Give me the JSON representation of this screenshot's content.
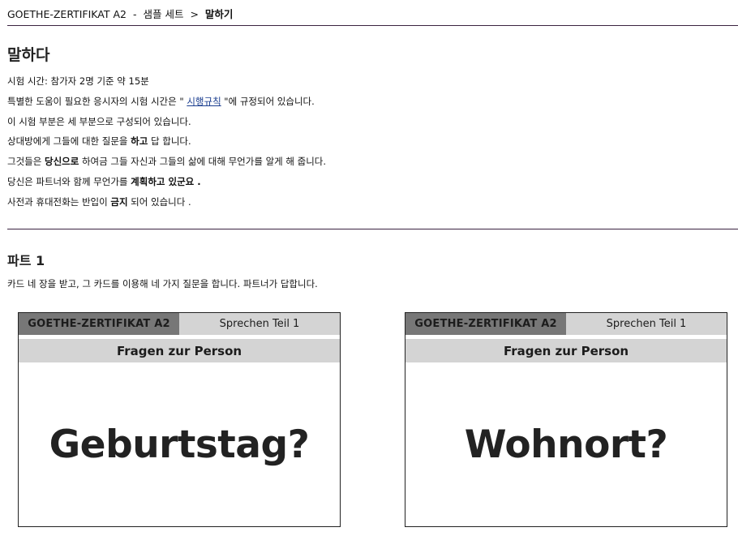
{
  "breadcrumb": {
    "exam": "GOETHE-ZERTIFIKAT A2",
    "dash": "-",
    "section": "샘플 세트",
    "separator": ">",
    "current": "말하기"
  },
  "heading": "말하다",
  "info": {
    "line1": "시험 시간: 참가자 2명 기준 약 15분",
    "line2_pre": "특별한 도움이 필요한 응시자의 시험 시간은 \" ",
    "line2_link": "시행규칙",
    "line2_post": " \"에 규정되어 있습니다.",
    "line3": "이 시험 부분은 세 부분으로 구성되어 있습니다.",
    "line4_pre": "상대방에게 그들에 대한 질문을 ",
    "line4_bold": "하고",
    "line4_post": " 답 합니다.",
    "line5_pre": "그것들은 ",
    "line5_bold": "당신으로",
    "line5_post": " 하여금 그들 자신과 그들의 삶에 대해 무언가를 알게 해 줍니다.",
    "line6_pre": "당신은 파트너와 함께 무언가를 ",
    "line6_bold": "계획하고 있군요 .",
    "line7_pre": "사전과 휴대전화는 반입이 ",
    "line7_bold": "금지",
    "line7_post": " 되어 있습니다 ."
  },
  "part1": {
    "title": "파트 1",
    "description": "카드 네 장을 받고, 그 카드를 이용해 네 가지 질문을 합니다. 파트너가 답합니다.",
    "cards": [
      {
        "exam": "GOETHE-ZERTIFIKAT A2",
        "teil": "Sprechen Teil 1",
        "subtitle": "Fragen zur Person",
        "word": "Geburtstag?"
      },
      {
        "exam": "GOETHE-ZERTIFIKAT A2",
        "teil": "Sprechen Teil 1",
        "subtitle": "Fragen zur Person",
        "word": "Wohnort?"
      }
    ]
  }
}
